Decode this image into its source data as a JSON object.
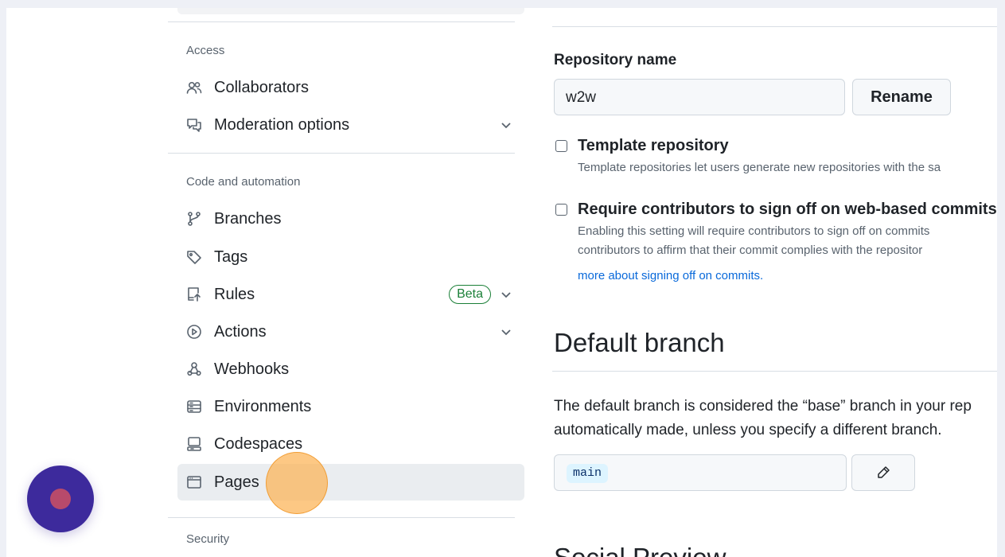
{
  "sidebar": {
    "sections": {
      "access": "Access",
      "code_automation": "Code and automation",
      "security": "Security"
    },
    "items": [
      {
        "label": "Collaborators",
        "icon": "people-icon"
      },
      {
        "label": "Moderation options",
        "icon": "comment-discussion-icon"
      },
      {
        "label": "Branches",
        "icon": "git-branch-icon"
      },
      {
        "label": "Tags",
        "icon": "tag-icon"
      },
      {
        "label": "Rules",
        "icon": "repo-push-icon",
        "badge": "Beta"
      },
      {
        "label": "Actions",
        "icon": "play-icon"
      },
      {
        "label": "Webhooks",
        "icon": "webhook-icon"
      },
      {
        "label": "Environments",
        "icon": "server-icon"
      },
      {
        "label": "Codespaces",
        "icon": "codespaces-icon"
      },
      {
        "label": "Pages",
        "icon": "browser-icon",
        "active": true
      }
    ]
  },
  "main": {
    "repo_name_label": "Repository name",
    "repo_name_value": "w2w",
    "rename_button": "Rename",
    "template_repo": {
      "title": "Template repository",
      "description": "Template repositories let users generate new repositories with the sa"
    },
    "signoff": {
      "title": "Require contributors to sign off on web-based commits",
      "line1": "Enabling this setting will require contributors to sign off on commits",
      "line2": "contributors to affirm that their commit complies with the repositor",
      "link": "more about signing off on commits."
    },
    "default_branch": {
      "heading": "Default branch",
      "line1": "The default branch is considered the “base” branch in your rep",
      "line2": "automatically made, unless you specify a different branch.",
      "branch": "main"
    },
    "next_heading": "Social Preview"
  },
  "colors": {
    "badge_green": "#1a7f37",
    "link_blue": "#0969da",
    "click_marker": "#fcb150",
    "fab": "#3d2a9c"
  }
}
